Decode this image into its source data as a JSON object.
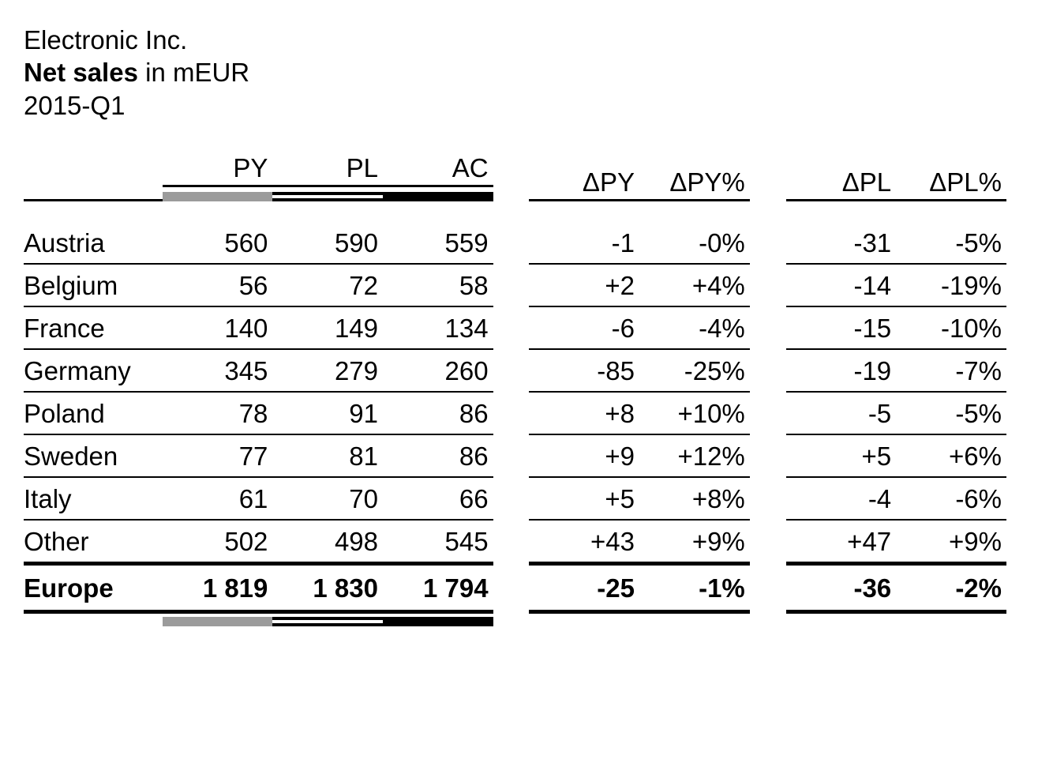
{
  "title": {
    "company": "Electronic Inc.",
    "metric_bold": "Net sales",
    "metric_rest": " in mEUR",
    "period": "2015-Q1"
  },
  "headers": {
    "py": "PY",
    "pl": "PL",
    "ac": "AC",
    "dpy": "ΔPY",
    "dpy_pct": "ΔPY%",
    "dpl": "ΔPL",
    "dpl_pct": "ΔPL%"
  },
  "rows": [
    {
      "label": "Austria",
      "py": "560",
      "pl": "590",
      "ac": "559",
      "dpy": "-1",
      "dpy_pct": "-0%",
      "dpl": "-31",
      "dpl_pct": "-5%"
    },
    {
      "label": "Belgium",
      "py": "56",
      "pl": "72",
      "ac": "58",
      "dpy": "+2",
      "dpy_pct": "+4%",
      "dpl": "-14",
      "dpl_pct": "-19%"
    },
    {
      "label": "France",
      "py": "140",
      "pl": "149",
      "ac": "134",
      "dpy": "-6",
      "dpy_pct": "-4%",
      "dpl": "-15",
      "dpl_pct": "-10%"
    },
    {
      "label": "Germany",
      "py": "345",
      "pl": "279",
      "ac": "260",
      "dpy": "-85",
      "dpy_pct": "-25%",
      "dpl": "-19",
      "dpl_pct": "-7%"
    },
    {
      "label": "Poland",
      "py": "78",
      "pl": "91",
      "ac": "86",
      "dpy": "+8",
      "dpy_pct": "+10%",
      "dpl": "-5",
      "dpl_pct": "-5%"
    },
    {
      "label": "Sweden",
      "py": "77",
      "pl": "81",
      "ac": "86",
      "dpy": "+9",
      "dpy_pct": "+12%",
      "dpl": "+5",
      "dpl_pct": "+6%"
    },
    {
      "label": "Italy",
      "py": "61",
      "pl": "70",
      "ac": "66",
      "dpy": "+5",
      "dpy_pct": "+8%",
      "dpl": "-4",
      "dpl_pct": "-6%"
    },
    {
      "label": "Other",
      "py": "502",
      "pl": "498",
      "ac": "545",
      "dpy": "+43",
      "dpy_pct": "+9%",
      "dpl": "+47",
      "dpl_pct": "+9%"
    }
  ],
  "total": {
    "label": "Europe",
    "py": "1 819",
    "pl": "1 830",
    "ac": "1 794",
    "dpy": "-25",
    "dpy_pct": "-1%",
    "dpl": "-36",
    "dpl_pct": "-2%"
  },
  "chart_data": {
    "type": "table",
    "title": "Electronic Inc. — Net sales in mEUR, 2015-Q1",
    "columns": [
      "PY",
      "PL",
      "AC",
      "ΔPY",
      "ΔPY%",
      "ΔPL",
      "ΔPL%"
    ],
    "categories": [
      "Austria",
      "Belgium",
      "France",
      "Germany",
      "Poland",
      "Sweden",
      "Italy",
      "Other",
      "Europe"
    ],
    "series": [
      {
        "name": "PY",
        "values": [
          560,
          56,
          140,
          345,
          78,
          77,
          61,
          502,
          1819
        ]
      },
      {
        "name": "PL",
        "values": [
          590,
          72,
          149,
          279,
          91,
          81,
          70,
          498,
          1830
        ]
      },
      {
        "name": "AC",
        "values": [
          559,
          58,
          134,
          260,
          86,
          86,
          66,
          545,
          1794
        ]
      },
      {
        "name": "ΔPY",
        "values": [
          -1,
          2,
          -6,
          -85,
          8,
          9,
          5,
          43,
          -25
        ]
      },
      {
        "name": "ΔPY%",
        "values": [
          0,
          4,
          -4,
          -25,
          10,
          12,
          8,
          9,
          -1
        ]
      },
      {
        "name": "ΔPL",
        "values": [
          -31,
          -14,
          -15,
          -19,
          -5,
          5,
          -4,
          47,
          -36
        ]
      },
      {
        "name": "ΔPL%",
        "values": [
          -5,
          -19,
          -10,
          -7,
          -5,
          6,
          -6,
          9,
          -2
        ]
      }
    ]
  }
}
